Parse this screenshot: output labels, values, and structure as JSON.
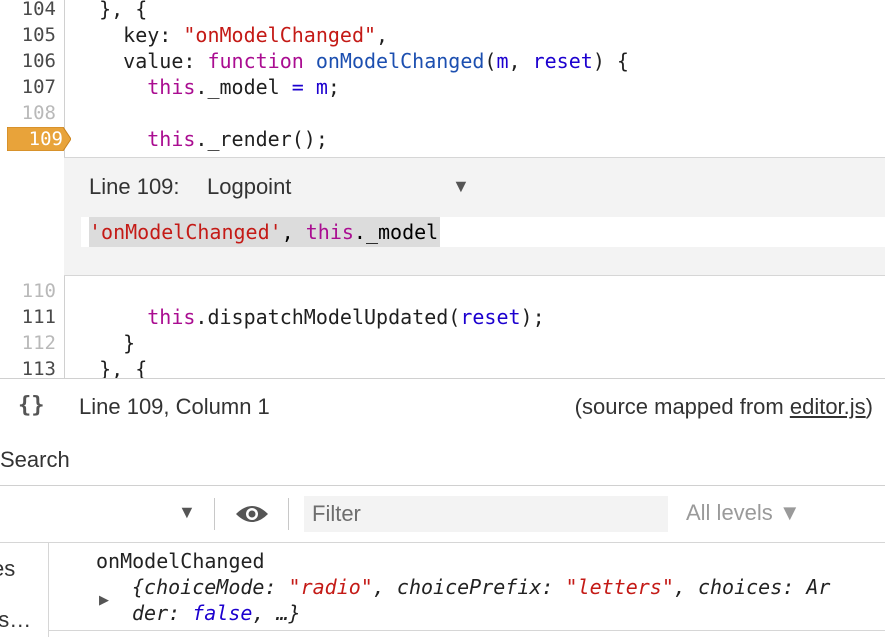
{
  "editor": {
    "lines": [
      {
        "num": "104",
        "code": "  }, {"
      },
      {
        "num": "105",
        "key": "key",
        "value": "\"onModelChanged\""
      },
      {
        "num": "106"
      },
      {
        "num": "107"
      },
      {
        "num": "108"
      },
      {
        "num": "109"
      },
      {
        "num": "110"
      },
      {
        "num": "111"
      },
      {
        "num": "112",
        "code": "    }"
      },
      {
        "num": "113",
        "code": "  }, {"
      }
    ],
    "breakpoint_line": "109"
  },
  "logpoint": {
    "line_label": "Line 109:",
    "type": "Logpoint",
    "expression": {
      "str": "'onModelChanged'",
      "sep": ", ",
      "kw": "this",
      "rest": "._model"
    }
  },
  "statusbar": {
    "pretty_print_icon": "{}",
    "position": "Line 109, Column 1",
    "source_prefix": "(source mapped from ",
    "source_file": "editor.js",
    "source_suffix": ")"
  },
  "search": {
    "label": "Search"
  },
  "console": {
    "filter_placeholder": "Filter",
    "levels": "All levels ▼",
    "icons": [
      "dropdown-arrow-icon",
      "eye-icon"
    ],
    "sidebar_items": [
      "es",
      "es…"
    ],
    "message": "onModelChanged",
    "object_line1": {
      "p1": "{choiceMode: ",
      "v1": "\"radio\"",
      "p2": ", choicePrefix: ",
      "v2": "\"letters\"",
      "p3": ", choices: Ar"
    },
    "object_line2": {
      "p1": "der: ",
      "v1": "false",
      "p2": ", …}"
    }
  }
}
